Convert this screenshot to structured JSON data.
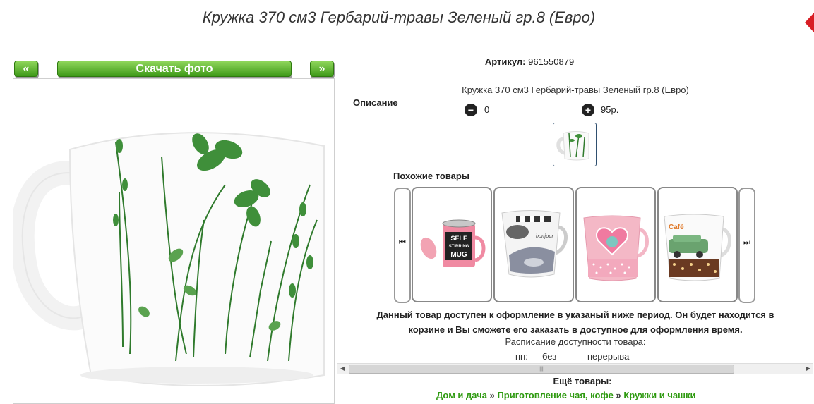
{
  "header": {
    "title": "Кружка 370 см3 Гербарий-травы Зеленый гр.8 (Евро)"
  },
  "gallery": {
    "prev_label": "«",
    "download_label": "Скачать фото",
    "next_label": "»"
  },
  "product": {
    "article_label": "Артикул:",
    "article_value": "961550879",
    "description_label": "Описание",
    "description_text": "Кружка 370 см3 Гербарий-травы Зеленый гр.8 (Евро)",
    "quantity": "0",
    "price": "95р."
  },
  "similar": {
    "label": "Похожие товары",
    "left_arrow": "⏮",
    "right_arrow": "⏭",
    "items": [
      {
        "mug_text_1": "SELF",
        "mug_text_2": "STIRRING",
        "mug_text_3": "MUG"
      },
      {
        "mug_text": "bonjour"
      },
      {
        "mug_text": ""
      },
      {
        "mug_text": "Café"
      }
    ]
  },
  "availability": {
    "text_line1": "Данный товар доступен к оформление в указаный ниже период. Он будет находится в",
    "text_line2": "корзине и Вы сможете его заказать в доступное для оформления время.",
    "schedule_title": "Расписание доступности товара:",
    "day": "пн:",
    "from": "без",
    "to": "перерыва"
  },
  "more": {
    "label": "Ещё товары:",
    "crumb1": "Дом и дача",
    "sep": "»",
    "crumb2": "Приготовление чая, кофе",
    "crumb3": "Кружки и чашки"
  },
  "colors": {
    "accent_green": "#3f9a19",
    "corner_red": "#d81d24",
    "herb_green": "#2f7a2c"
  }
}
